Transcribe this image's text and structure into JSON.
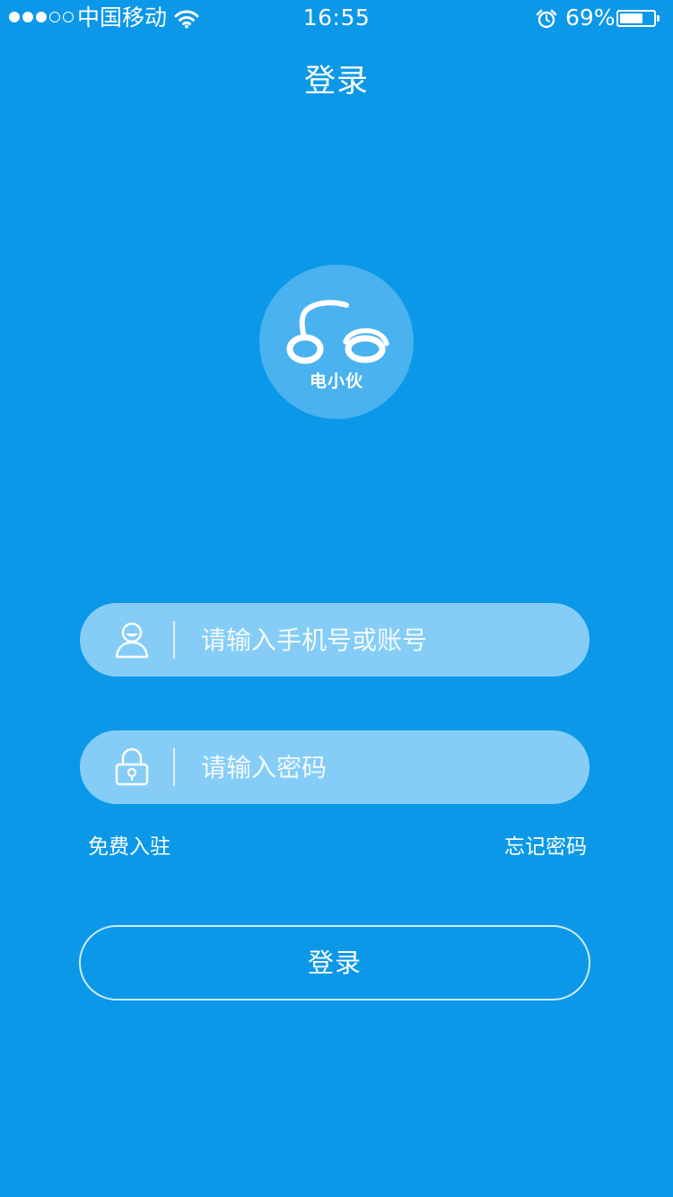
{
  "status_bar": {
    "signal": {
      "filled": 3,
      "total": 5
    },
    "carrier": "中国移动",
    "wifi_icon": "wifi-icon",
    "time": "16:55",
    "alarm_icon": "alarm-icon",
    "battery_percent": "69%",
    "battery_level": 0.69
  },
  "nav": {
    "title": "登录"
  },
  "logo": {
    "text": "电小伙",
    "icon": "scooter-logo-icon"
  },
  "form": {
    "username": {
      "icon": "user-icon",
      "placeholder": "请输入手机号或账号",
      "value": ""
    },
    "password": {
      "icon": "lock-icon",
      "placeholder": "请输入密码",
      "value": ""
    }
  },
  "links": {
    "register": "免费入驻",
    "forgot_password": "忘记密码"
  },
  "login_button": {
    "label": "登录"
  },
  "colors": {
    "background": "#0b98e8",
    "field_background": "#85cdf6",
    "logo_circle": "#4ab2ef",
    "text": "#ffffff"
  }
}
